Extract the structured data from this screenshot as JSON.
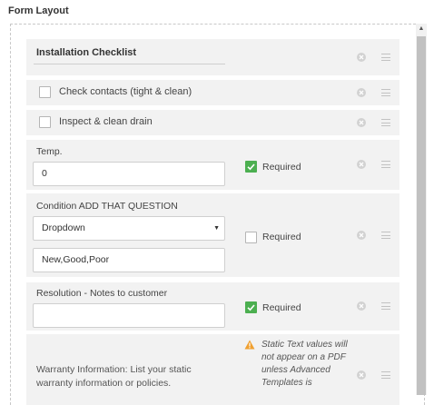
{
  "page": {
    "title": "Form Layout"
  },
  "form": {
    "section_title": "Installation Checklist",
    "checkboxes": [
      {
        "label": "Check contacts (tight & clean)"
      },
      {
        "label": "Inspect & clean drain"
      }
    ],
    "temp": {
      "label": "Temp.",
      "value": "0",
      "required_label": "Required",
      "required": true
    },
    "condition": {
      "label": "Condition ADD THAT QUESTION",
      "type_value": "Dropdown",
      "options_value": "New,Good,Poor",
      "required_label": "Required",
      "required": false
    },
    "resolution": {
      "label": "Resolution - Notes to customer",
      "value": "",
      "required_label": "Required",
      "required": true
    },
    "warranty": {
      "text": "Warranty Information: List your static warranty information or policies.",
      "warning": "Static Text values will not appear on a PDF unless Advanced Templates is"
    }
  },
  "colors": {
    "required_check": "#4caf50",
    "warning": "#f0a030",
    "row_bg": "#f2f2f2"
  },
  "icons": {
    "remove": "close-circle-icon",
    "drag": "drag-handle-icon",
    "warning": "warning-icon",
    "select": "caret-down-icon"
  }
}
